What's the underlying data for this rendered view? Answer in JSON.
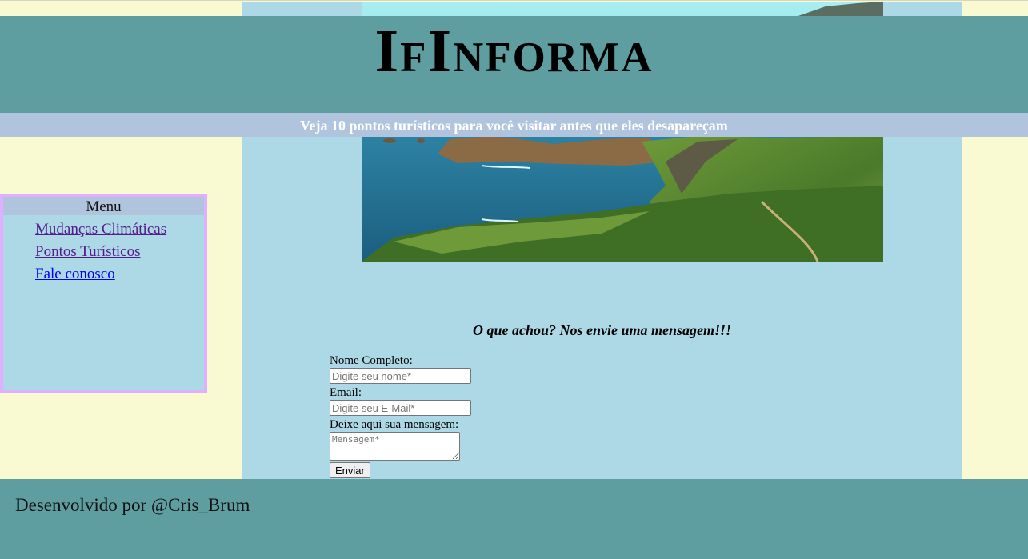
{
  "header": {
    "site_title": "IfInforma",
    "subtitle": "Veja 10 pontos turísticos para você visitar antes que eles desapareçam"
  },
  "menu": {
    "title": "Menu",
    "items": [
      {
        "label": "Mudanças Climáticas",
        "state": "visited"
      },
      {
        "label": "Pontos Turísticos",
        "state": "visited"
      },
      {
        "label": "Fale conosco",
        "state": "unvisited"
      }
    ]
  },
  "hero": {
    "icon": "coastal-cliff-landscape-image"
  },
  "contact_form": {
    "heading": "O que achou? Nos envie uma mensagem!!!",
    "name_label": "Nome Completo:",
    "name_placeholder": "Digite seu nome*",
    "email_label": "Email:",
    "email_placeholder": "Digite seu E-Mail*",
    "message_label": "Deixe aqui sua mensagem:",
    "message_placeholder": "Mensagem*",
    "submit_label": "Enviar"
  },
  "footer": {
    "text": "Desenvolvido por @Cris_Brum"
  },
  "colors": {
    "page_background": "#fafad2",
    "content_background": "#add8e6",
    "header_background": "#5f9ea0",
    "subheader_background": "#b0c4de",
    "menu_border": "#e0b0ff",
    "visited_link": "#551a8b",
    "link": "#0000ee"
  }
}
